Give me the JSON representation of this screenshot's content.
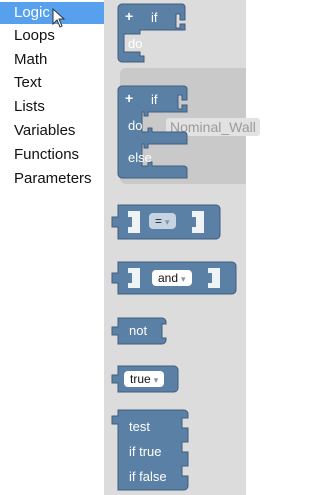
{
  "toolbox": {
    "categories": [
      {
        "label": "Logic"
      },
      {
        "label": "Loops"
      },
      {
        "label": "Math"
      },
      {
        "label": "Text"
      },
      {
        "label": "Lists"
      },
      {
        "label": "Variables"
      },
      {
        "label": "Functions"
      },
      {
        "label": "Parameters"
      }
    ],
    "selected_index": 0
  },
  "flyout": {
    "if_block": {
      "mutator": "+",
      "if_label": "if",
      "do_label": "do"
    },
    "if_else_block": {
      "mutator": "+",
      "if_label": "if",
      "do_label": "do",
      "else_label": "else"
    },
    "ghost_block": {
      "text": "Nominal_Wall"
    },
    "compare_block": {
      "operator": "=",
      "arrow": "▾"
    },
    "logic_op_block": {
      "operator": "and",
      "arrow": "▾"
    },
    "not_block": {
      "label": "not"
    },
    "boolean_block": {
      "value": "true",
      "arrow": "▾"
    },
    "ternary_block": {
      "test_label": "test",
      "if_true_label": "if true",
      "if_false_label": "if false"
    }
  },
  "colors": {
    "block": "#5b80a5",
    "selected_category": "#57a0ee",
    "flyout_background": "#dcdcdc"
  }
}
